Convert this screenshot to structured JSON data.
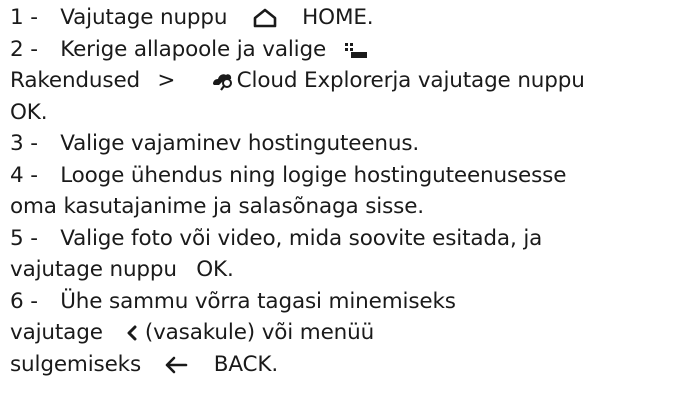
{
  "steps": {
    "s1": {
      "num": "1 -",
      "text": "Vajutage nuppu",
      "button": "HOME",
      "end": "."
    },
    "s2": {
      "num": "2 -",
      "text": "Kerige allapoole ja valige",
      "menu": "Rakendused",
      "sep": ">",
      "app": "Cloud Explorer",
      "text2": "ja vajutage nuppu",
      "button": "OK",
      "end": "."
    },
    "s3": {
      "num": "3 -",
      "text": "Valige vajaminev hostinguteenus."
    },
    "s4": {
      "num": "4 -",
      "text": "Looge ühendus ning logige hostinguteenusesse",
      "text_cont": "oma kasutajanime ja salasõnaga sisse."
    },
    "s5": {
      "num": "5 -",
      "text": "Valige foto või video, mida soovite esitada, ja",
      "text_cont": "vajutage nuppu",
      "button": "OK",
      "end": "."
    },
    "s6": {
      "num": "6 -",
      "text": "Ühe sammu võrra tagasi minemiseks",
      "text_cont": "vajutage",
      "left_label": "(vasakule) või menüü",
      "text_cont2": "sulgemiseks",
      "button": "BACK",
      "end": "."
    }
  },
  "icons": {
    "home": "home-icon",
    "apps": "apps-icon",
    "cloud": "cloud-search-icon",
    "left": "chevron-left-icon",
    "back": "back-arrow-icon"
  }
}
